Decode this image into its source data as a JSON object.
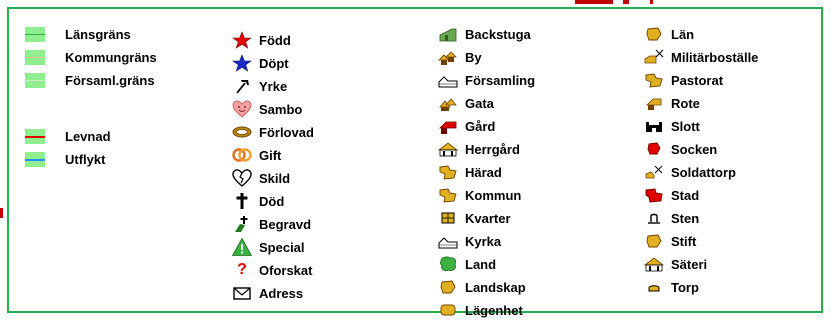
{
  "legend": {
    "boundaries": [
      {
        "label": "Länsgräns",
        "color": "#22b14c"
      },
      {
        "label": "Kommungräns",
        "color": "#e3c090"
      },
      {
        "label": "Församl.gräns",
        "color": "#d7ead0"
      }
    ],
    "routes": [
      {
        "label": "Levnad",
        "color": "#e00000"
      },
      {
        "label": "Utflykt",
        "color": "#1e90ff"
      }
    ],
    "events": [
      {
        "label": "Född",
        "icon": "star-icon",
        "color": "#e00000"
      },
      {
        "label": "Döpt",
        "icon": "star-icon",
        "color": "#1a2ac8"
      },
      {
        "label": "Yrke",
        "icon": "hammer-icon",
        "color": "#000000"
      },
      {
        "label": "Sambo",
        "icon": "heart-face-icon",
        "color": "#f4a0a0"
      },
      {
        "label": "Förlovad",
        "icon": "rings-icon",
        "color": "#b8860b"
      },
      {
        "label": "Gift",
        "icon": "wedding-rings-icon",
        "color": "#e07020"
      },
      {
        "label": "Skild",
        "icon": "broken-heart-icon",
        "color": "#000000"
      },
      {
        "label": "Död",
        "icon": "cross-icon",
        "color": "#000000"
      },
      {
        "label": "Begravd",
        "icon": "grave-icon",
        "color": "#1f7a1f"
      },
      {
        "label": "Special",
        "icon": "warning-icon",
        "color": "#3cb043"
      },
      {
        "label": "Oforskat",
        "icon": "question-icon",
        "color": "#e00000"
      },
      {
        "label": "Adress",
        "icon": "envelope-icon",
        "color": "#000000"
      }
    ],
    "places_1": [
      {
        "label": "Backstuga",
        "icon": "cottage-icon",
        "color": "#6aa84f"
      },
      {
        "label": "By",
        "icon": "village-icon",
        "color": "#e0b020"
      },
      {
        "label": "Församling",
        "icon": "parish-icon",
        "color": "#ffffff"
      },
      {
        "label": "Gata",
        "icon": "street-icon",
        "color": "#e0b020"
      },
      {
        "label": "Gård",
        "icon": "farm-icon",
        "color": "#e00000"
      },
      {
        "label": "Herrgård",
        "icon": "manor-icon",
        "color": "#e0b020"
      },
      {
        "label": "Härad",
        "icon": "district-icon",
        "color": "#e0b020"
      },
      {
        "label": "Kommun",
        "icon": "municipality-icon",
        "color": "#e0b020"
      },
      {
        "label": "Kvarter",
        "icon": "block-icon",
        "color": "#e0b020"
      },
      {
        "label": "Kyrka",
        "icon": "church-icon",
        "color": "#ffffff"
      },
      {
        "label": "Land",
        "icon": "country-icon",
        "color": "#3cb043"
      },
      {
        "label": "Landskap",
        "icon": "province-icon",
        "color": "#e0b020"
      },
      {
        "label": "Lägenhet",
        "icon": "apartment-icon",
        "color": "#e0b020"
      }
    ],
    "places_2": [
      {
        "label": "Län",
        "icon": "county-icon",
        "color": "#e0b020"
      },
      {
        "label": "Militärboställe",
        "icon": "military-icon",
        "color": "#e0b020"
      },
      {
        "label": "Pastorat",
        "icon": "pastorate-icon",
        "color": "#e0b020"
      },
      {
        "label": "Rote",
        "icon": "rote-icon",
        "color": "#e0b020"
      },
      {
        "label": "Slott",
        "icon": "castle-icon",
        "color": "#000000"
      },
      {
        "label": "Socken",
        "icon": "socken-icon",
        "color": "#e00000"
      },
      {
        "label": "Soldattorp",
        "icon": "soldier-cottage-icon",
        "color": "#e0b020"
      },
      {
        "label": "Stad",
        "icon": "city-icon",
        "color": "#e00000"
      },
      {
        "label": "Sten",
        "icon": "stone-icon",
        "color": "#000000"
      },
      {
        "label": "Stift",
        "icon": "diocese-icon",
        "color": "#e0b020"
      },
      {
        "label": "Säteri",
        "icon": "estate-icon",
        "color": "#e0b020"
      },
      {
        "label": "Torp",
        "icon": "croft-icon",
        "color": "#e0b020"
      }
    ]
  }
}
